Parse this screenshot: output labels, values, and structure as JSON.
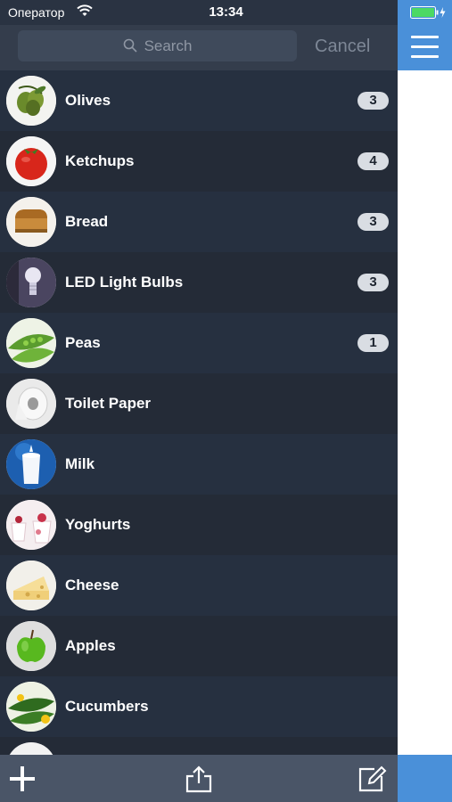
{
  "status_bar": {
    "carrier": "Оператор",
    "time": "13:34"
  },
  "search": {
    "placeholder": "Search",
    "cancel_label": "Cancel"
  },
  "items": [
    {
      "name": "Olives",
      "count": "3",
      "icon": "olives-icon"
    },
    {
      "name": "Ketchups",
      "count": "4",
      "icon": "tomato-icon"
    },
    {
      "name": "Bread",
      "count": "3",
      "icon": "bread-icon"
    },
    {
      "name": "LED Light Bulbs",
      "count": "3",
      "icon": "light-bulb-icon"
    },
    {
      "name": "Peas",
      "count": "1",
      "icon": "peas-icon"
    },
    {
      "name": "Toilet Paper",
      "count": "",
      "icon": "toilet-paper-icon"
    },
    {
      "name": "Milk",
      "count": "",
      "icon": "milk-icon"
    },
    {
      "name": "Yoghurts",
      "count": "",
      "icon": "yoghurt-icon"
    },
    {
      "name": "Cheese",
      "count": "",
      "icon": "cheese-icon"
    },
    {
      "name": "Apples",
      "count": "",
      "icon": "apple-icon"
    },
    {
      "name": "Cucumbers",
      "count": "",
      "icon": "cucumber-icon"
    }
  ],
  "toolbar": {
    "add_icon": "plus-icon",
    "share_icon": "share-icon",
    "edit_icon": "compose-icon"
  },
  "colors": {
    "accent": "#4a90d9",
    "list_background": "#242b37",
    "header_background": "#343d4c",
    "toolbar_background": "#4a5567"
  }
}
